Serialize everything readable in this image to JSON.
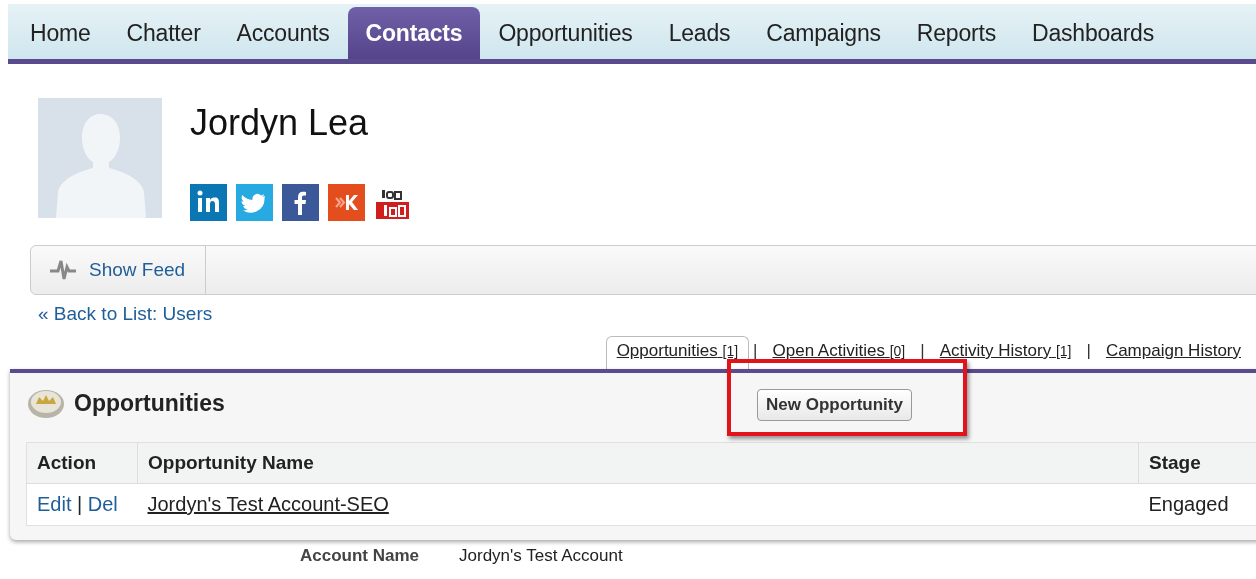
{
  "nav_tabs": [
    {
      "label": "Home",
      "selected": false
    },
    {
      "label": "Chatter",
      "selected": false
    },
    {
      "label": "Accounts",
      "selected": false
    },
    {
      "label": "Contacts",
      "selected": true
    },
    {
      "label": "Opportunities",
      "selected": false
    },
    {
      "label": "Leads",
      "selected": false
    },
    {
      "label": "Campaigns",
      "selected": false
    },
    {
      "label": "Reports",
      "selected": false
    },
    {
      "label": "Dashboards",
      "selected": false
    }
  ],
  "profile": {
    "name": "Jordyn Lea",
    "social": [
      {
        "kind": "linkedin"
      },
      {
        "kind": "twitter"
      },
      {
        "kind": "facebook"
      },
      {
        "kind": "klout"
      },
      {
        "kind": "youtube"
      }
    ]
  },
  "feed_button": "Show Feed",
  "back_link": "« Back to List: Users",
  "related_tabs": [
    {
      "label": "Opportunities",
      "count": "[1]",
      "selected": true
    },
    {
      "label": "Open Activities",
      "count": "[0]",
      "selected": false
    },
    {
      "label": "Activity History",
      "count": "[1]",
      "selected": false
    },
    {
      "label": "Campaign History",
      "selected": false
    }
  ],
  "related_separator": "|",
  "panel": {
    "title": "Opportunities",
    "button": "New Opportunity",
    "highlighted": true,
    "columns": [
      "Action",
      "Opportunity Name",
      "Stage"
    ],
    "rows": [
      {
        "actions": [
          "Edit",
          "Del"
        ],
        "separator": "|",
        "name": "Jordyn's Test Account-SEO",
        "stage": "Engaged"
      }
    ]
  },
  "detail": {
    "label": "Account Name",
    "value": "Jordyn's Test Account"
  }
}
